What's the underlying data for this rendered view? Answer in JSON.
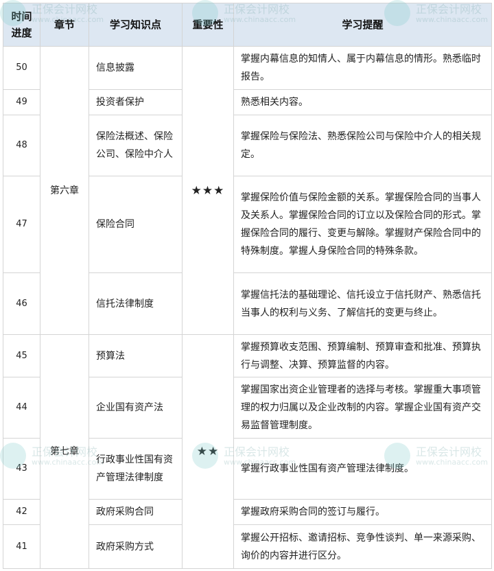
{
  "headers": {
    "time": "时间进度",
    "chapter": "章节",
    "point": "学习知识点",
    "importance": "重要性",
    "tip": "学习提醒"
  },
  "chapters": [
    {
      "name": "第六章",
      "importance": "★★★"
    },
    {
      "name": "第七章",
      "importance": "★★"
    }
  ],
  "rows": [
    {
      "num": "50",
      "point": "信息披露",
      "tip": "掌握内幕信息的知情人、属于内幕信息的情形。熟悉临时报告。"
    },
    {
      "num": "49",
      "point": "投资者保护",
      "tip": "熟悉相关内容。"
    },
    {
      "num": "48",
      "point": "保险法概述、保险公司、保险中介人",
      "tip": "掌握保险与保险法、熟悉保险公司与保险中介人的相关规定。"
    },
    {
      "num": "47",
      "point": "保险合同",
      "tip": "掌握保险价值与保险金额的关系。掌握保险合同的当事人及关系人。掌握保险合同的订立以及保险合同的形式。掌握保险合同的履行、变更与解除。掌握财产保险合同中的特殊制度。掌握人身保险合同的特殊条款。"
    },
    {
      "num": "46",
      "point": "信托法律制度",
      "tip": "掌握信托法的基础理论、信托设立于信托财产、熟悉信托当事人的权利与义务、了解信托的变更与终止。"
    },
    {
      "num": "45",
      "point": "预算法",
      "tip": "掌握预算收支范围、预算编制、预算审查和批准、预算执行与调整、决算、预算监督的内容。"
    },
    {
      "num": "44",
      "point": "企业国有资产法",
      "tip": "掌握国家出资企业管理者的选择与考核。掌握重大事项管理的权力归属以及企业改制的内容。掌握企业国有资产交易监督管理制度。"
    },
    {
      "num": "43",
      "point": "行政事业性国有资产管理法律制度",
      "tip": "掌握行政事业性国有资产管理法律制度。"
    },
    {
      "num": "42",
      "point": "政府采购合同",
      "tip": "掌握政府采购合同的签订与履行。"
    },
    {
      "num": "41",
      "point": "政府采购方式",
      "tip": "掌握公开招标、邀请招标、竞争性谈判、单一来源采购、询价的内容并进行区分。"
    }
  ],
  "watermark": {
    "name": "正保会计网校",
    "url": "www.chinaacc.com"
  }
}
